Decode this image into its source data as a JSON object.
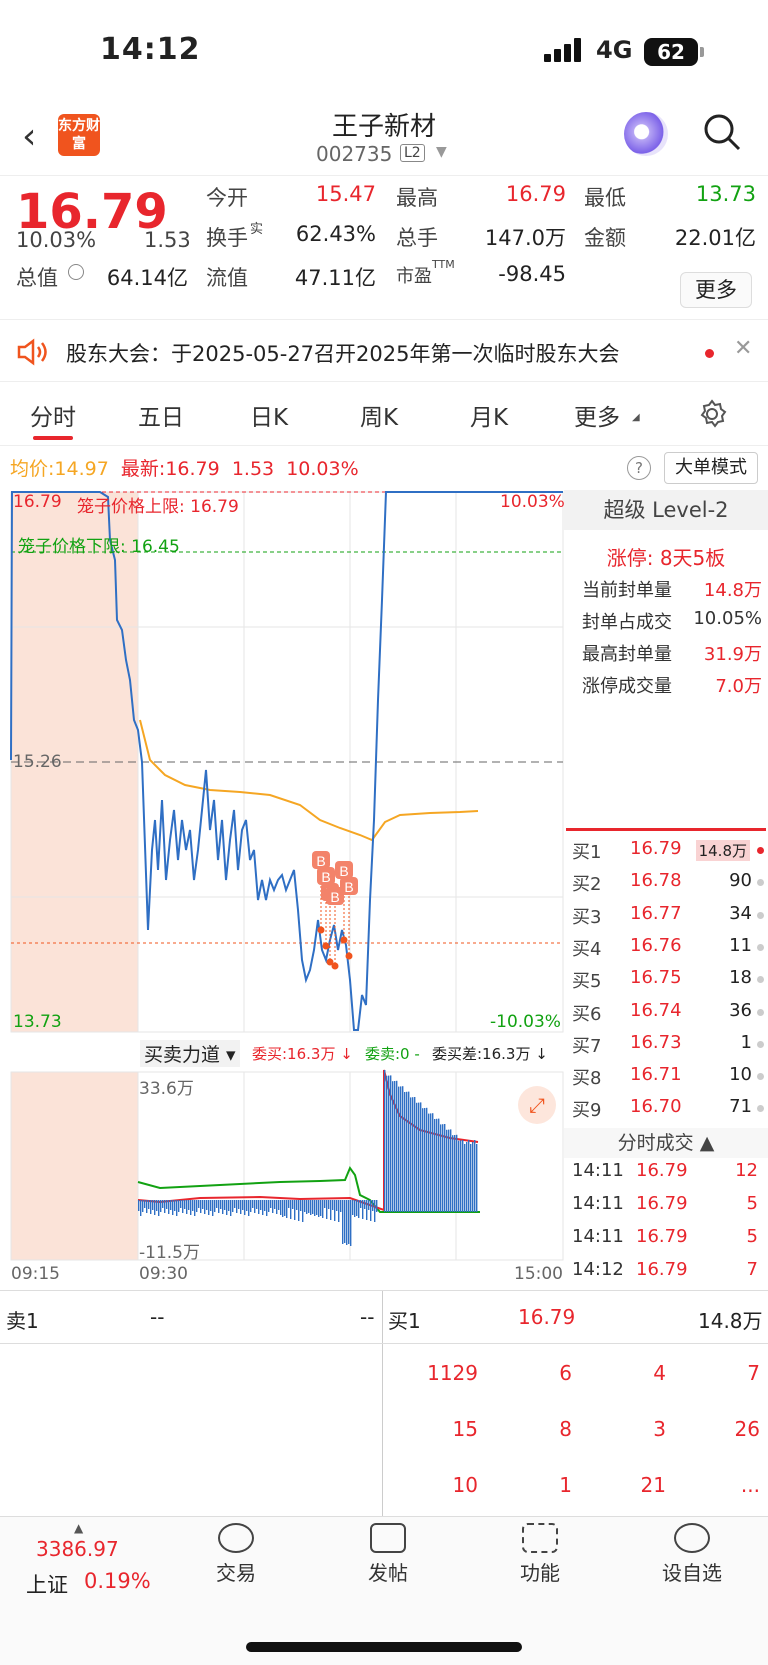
{
  "status": {
    "time": "14:12",
    "network": "4G",
    "battery": "62"
  },
  "header": {
    "logo": "东方财富",
    "name": "王子新材",
    "code": "002735",
    "level": "L2"
  },
  "quote": {
    "price": "16.79",
    "change_pct": "10.03%",
    "change": "1.53",
    "open_label": "今开",
    "open": "15.47",
    "high_label": "最高",
    "high": "16.79",
    "low_label": "最低",
    "low": "13.73",
    "turnover_label": "换手",
    "turnover_sup": "实",
    "turnover": "62.43%",
    "vol_label": "总手",
    "vol": "147.0万",
    "amount_label": "金额",
    "amount": "22.01亿",
    "mcap_label": "总值",
    "mcap": "64.14亿",
    "float_label": "流值",
    "float": "47.11亿",
    "pe_label": "市盈",
    "pe_sup": "TTM",
    "pe": "-98.45",
    "more": "更多"
  },
  "notice": {
    "text": "股东大会：于2025-05-27召开2025年第一次临时股东大会"
  },
  "tabs": [
    "分时",
    "五日",
    "日K",
    "周K",
    "月K",
    "更多"
  ],
  "chart": {
    "avg_label": "均价:",
    "avg": "14.97",
    "latest_label": "最新:",
    "latest": "16.79",
    "chg": "1.53",
    "pct": "10.03%",
    "big_mode": "大单模式",
    "top_price": "16.79",
    "top_pct": "10.03%",
    "upper_cage": "笼子价格上限: 16.79",
    "lower_cage": "笼子价格下限: 16.45",
    "mid_price": "15.26",
    "bot_price": "13.73",
    "bot_pct": "-10.03%",
    "indicator": "买卖力道",
    "wt_buy": "委买:16.3万",
    "wt_sell": "委卖:0",
    "wt_diff": "委买差:16.3万",
    "ind_top": "33.6万",
    "ind_bot": "-11.5万",
    "t0": "09:15",
    "t1": "09:30",
    "t2": "15:00",
    "b_marks": [
      "B",
      "B",
      "B",
      "B",
      "B",
      "B"
    ]
  },
  "level2": {
    "title": "超级 Level-2",
    "limit_up": "涨停: 8天5板",
    "rows": [
      {
        "label": "当前封单量",
        "value": "14.8万"
      },
      {
        "label": "封单占成交",
        "value": "10.05%"
      },
      {
        "label": "最高封单量",
        "value": "31.9万"
      },
      {
        "label": "涨停成交量",
        "value": "7.0万"
      }
    ]
  },
  "orderbook": [
    {
      "side": "买1",
      "price": "16.79",
      "vol": "14.8万"
    },
    {
      "side": "买2",
      "price": "16.78",
      "vol": "90"
    },
    {
      "side": "买3",
      "price": "16.77",
      "vol": "34"
    },
    {
      "side": "买4",
      "price": "16.76",
      "vol": "11"
    },
    {
      "side": "买5",
      "price": "16.75",
      "vol": "18"
    },
    {
      "side": "买6",
      "price": "16.74",
      "vol": "36"
    },
    {
      "side": "买7",
      "price": "16.73",
      "vol": "1"
    },
    {
      "side": "买8",
      "price": "16.71",
      "vol": "10"
    },
    {
      "side": "买9",
      "price": "16.70",
      "vol": "71"
    }
  ],
  "trades_title": "分时成交",
  "trades": [
    {
      "t": "14:11",
      "p": "16.79",
      "q": "12"
    },
    {
      "t": "14:11",
      "p": "16.79",
      "q": "5"
    },
    {
      "t": "14:11",
      "p": "16.79",
      "q": "5"
    },
    {
      "t": "14:12",
      "p": "16.79",
      "q": "7"
    }
  ],
  "book_detail": {
    "sell_label": "卖1",
    "sell_a": "--",
    "sell_b": "--",
    "buy_label": "买1",
    "buy_price": "16.79",
    "buy_vol": "14.8万",
    "queue": [
      [
        "1129",
        "6",
        "4",
        "7"
      ],
      [
        "15",
        "8",
        "3",
        "26"
      ],
      [
        "10",
        "1",
        "21",
        "..."
      ]
    ]
  },
  "nav": {
    "index_value": "3386.97",
    "index_name": "上证",
    "index_pct": "0.19%",
    "items": [
      "交易",
      "发帖",
      "功能",
      "设自选"
    ]
  },
  "colors": {
    "up": "#e8262d",
    "down": "#12a212",
    "price_line": "#2f6fc4",
    "avg_line": "#f5a623"
  }
}
